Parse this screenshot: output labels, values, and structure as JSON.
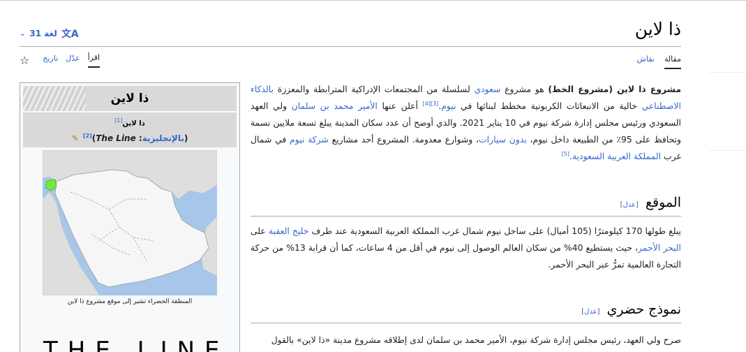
{
  "page": {
    "title": "ذا لاين",
    "languages_label": "31 لغة"
  },
  "tabs": {
    "article": "مقالة",
    "talk": "نقاش",
    "read": "اقرأ",
    "edit": "عدّل",
    "history": "تاريخ"
  },
  "intro": {
    "bold": "مشروع ذا لاين (مشروع الخط)",
    "t1": " هو مشروع ",
    "l_saudi": "سعودي",
    "t2": " لسلسلة من المجتمعات الإدراكية المترابطة والمعززة ",
    "l_ai": "بالذكاء الاصطناعي",
    "t3": " خالية من الانبعاثات الكربونية مخطط لبنائها في ",
    "l_neom": "نيوم",
    "t4": ".",
    "ref3": "[3]",
    "ref4": "[4]",
    "t5": " أعلن عنها ",
    "l_mbs": "الأمير محمد بن سلمان",
    "t6": " ولي العهد السعودي ورئيس مجلس إدارة شركة نيوم في 10 يناير 2021. والذي أوضح أن عدد سكان المدينة يبلغ تسعة ملايين نسمة وتحافظ على 95٪ من الطبيعة داخل نيوم، ",
    "l_cars": "بدون سيارات",
    "t7": "، وشوارع معدومة. المشروع أحد مشاريع ",
    "l_neomco": "شركة نيوم",
    "t8": " في شمال غرب ",
    "l_ksa": "المملكة العربية السعودية",
    "t9": ".",
    "ref5": "[5]"
  },
  "section_location": {
    "heading": "الموقع",
    "edit_open": "[",
    "edit_label": "عدل",
    "edit_close": "]",
    "t1": "يبلغ طولها 170 كيلومترًا (105 أميال) على ساحل نيوم شمال غرب المملكة العربية السعودية عند طرف ",
    "l_gulf": "خليج العقبة",
    "t2": " على ",
    "l_redsea": "البحر الأحمر",
    "t3": "، حيث يستطيع 40% من سكان العالم الوصول إلى نيوم في أقل من 4 ساعات، كما أن قرابة 13% من حركة التجارة العالمية تمرُّ عبر البحر الأحمر."
  },
  "section_model": {
    "heading": "نموذج حضري",
    "edit_open": "[",
    "edit_label": "عدل",
    "edit_close": "]",
    "text": "صرح ولي العهد، رئيس مجلس إدارة شركة نيوم، الأمير محمد بن سلمان لدى إطلاقه مشروع مدينة «ذا لاين» بالقول"
  },
  "infobox": {
    "title": "ذا لاين",
    "name": "ذا لاين",
    "ref1": "[1]",
    "en_prefix": "(",
    "en_lang": "بالإنجليزية",
    "en_colon": ": ",
    "en_name": "The Line",
    "en_suffix": ")",
    "ref2": "[2]",
    "caption": "المنطقة الخضراء تشير إلى موقع مشروع ذا لاين",
    "logo_text": "THE LINE"
  },
  "colors": {
    "link": "#3366cc",
    "map_land": "#f6f6f6",
    "map_sea": "#a7c7ea",
    "highlight": "#76ea3c"
  }
}
